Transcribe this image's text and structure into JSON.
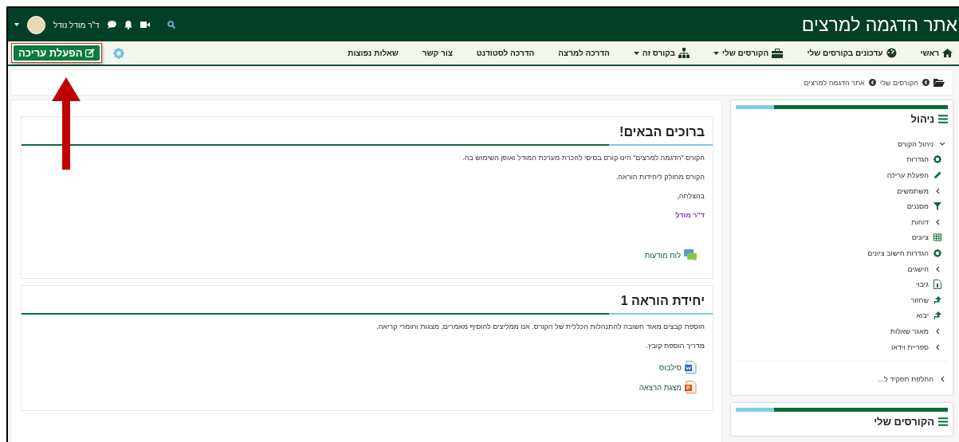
{
  "header": {
    "site_title": "אתר הדגמה למרצים",
    "user_name": "ד\"ר מודל נודל"
  },
  "nav": {
    "items": [
      {
        "label": "ראשי",
        "kind": "home",
        "has_menu": false
      },
      {
        "label": "עדכונים בקורסים שלי",
        "kind": "dashboard",
        "has_menu": false
      },
      {
        "label": "הקורסים שלי",
        "kind": "courses",
        "has_menu": true
      },
      {
        "label": "בקורס זה",
        "kind": "course",
        "has_menu": true
      },
      {
        "label": "הדרכה למרצה",
        "kind": "plain",
        "has_menu": false
      },
      {
        "label": "הדרכה לסטודנט",
        "kind": "plain",
        "has_menu": false
      },
      {
        "label": "צור קשר",
        "kind": "plain",
        "has_menu": false
      },
      {
        "label": "שאלות נפוצות",
        "kind": "plain",
        "has_menu": false
      }
    ],
    "edit_button": {
      "label": "הפעלת עריכה"
    }
  },
  "breadcrumb": [
    "הקורסים שלי",
    "אתר הדגמה למרצים"
  ],
  "sidebar": {
    "blocks": [
      {
        "title": "ניהול",
        "tree": [
          {
            "label": "ניהול הקורס",
            "kind": "branch",
            "expanded": true,
            "children": [
              {
                "label": "הגדרות",
                "kind": "settings"
              },
              {
                "label": "הפעלת עריכה",
                "kind": "edit"
              },
              {
                "label": "משתמשים",
                "kind": "branch",
                "expanded": false
              },
              {
                "label": "מסננים",
                "kind": "filter"
              },
              {
                "label": "דוחות",
                "kind": "branch",
                "expanded": false
              },
              {
                "label": "ציונים",
                "kind": "grades"
              },
              {
                "label": "הגדרות חישוב ציונים",
                "kind": "settings"
              },
              {
                "label": "הישגים",
                "kind": "branch",
                "expanded": false
              },
              {
                "label": "גיבוי",
                "kind": "backup"
              },
              {
                "label": "שחזור",
                "kind": "restore"
              },
              {
                "label": "יבוא",
                "kind": "restore"
              },
              {
                "label": "מאגר שאלות",
                "kind": "branch",
                "expanded": false
              },
              {
                "label": "ספריית וידאו",
                "kind": "branch",
                "expanded": false
              }
            ]
          }
        ],
        "footer": [
          {
            "label": "החלפת תפקיד ל...",
            "kind": "branch",
            "expanded": false
          }
        ]
      },
      {
        "title": "הקורסים שלי"
      }
    ]
  },
  "sections": [
    {
      "title": "ברוכים הבאים!",
      "paragraphs": [
        {
          "kind": "text",
          "text": "הקורס \"הדגמה למרצים\" הינו קורס בסיסי להכרת מערכת המודל ואופן השימוש בה."
        },
        {
          "kind": "text",
          "text": "הקורס מחולק ליחידות הוראה."
        },
        {
          "kind": "text",
          "text": "בהצלחה,"
        },
        {
          "kind": "signature",
          "text": "ד\"ר מודל"
        }
      ],
      "activities": [
        {
          "label": "לוח מודעות",
          "kind": "forum"
        }
      ]
    },
    {
      "title": "יחידת הוראה 1",
      "paragraphs": [
        {
          "kind": "text",
          "text": "הוספת קבצים מאוד חשובה להתנהלות הכללית של הקורס. אנו ממליצים להוסיף מאמרים, מצגות וחומרי קריאה."
        },
        {
          "kind": "text",
          "text": "מדריך הוספת קובץ."
        }
      ],
      "activities": [
        {
          "label": "סילבוס",
          "kind": "word"
        },
        {
          "label": "מצגת הרצאה",
          "kind": "powerpoint"
        }
      ]
    }
  ]
}
